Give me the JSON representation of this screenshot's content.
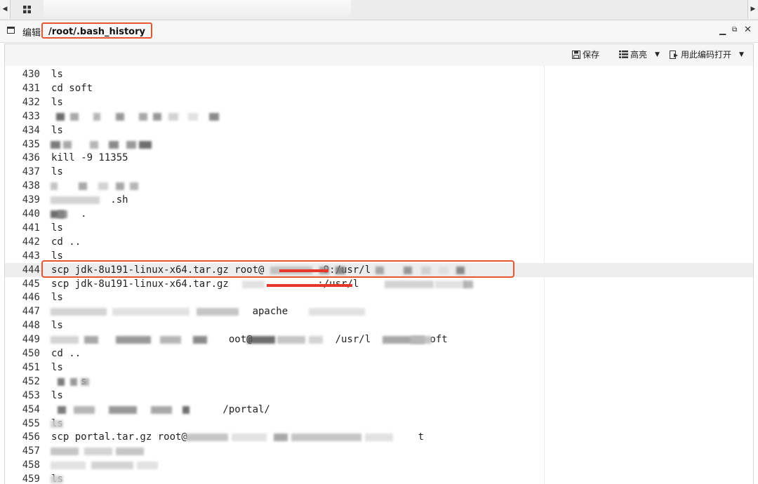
{
  "window": {
    "title_label": "编辑",
    "file_path": "/root/.bash_history"
  },
  "toolbar": {
    "save_label": "保存",
    "highlight_label": "高亮",
    "open_with_encoding_label": "用此编码打开"
  },
  "editor": {
    "lines": [
      {
        "num": "430",
        "text": "ls"
      },
      {
        "num": "431",
        "text": "cd soft"
      },
      {
        "num": "432",
        "text": "ls"
      },
      {
        "num": "433",
        "text": ""
      },
      {
        "num": "434",
        "text": "ls"
      },
      {
        "num": "435",
        "text": ""
      },
      {
        "num": "436",
        "text": "kill -9 11355"
      },
      {
        "num": "437",
        "text": "ls"
      },
      {
        "num": "438",
        "text": ""
      },
      {
        "num": "439",
        "text": "          .sh"
      },
      {
        "num": "440",
        "text": "     ."
      },
      {
        "num": "441",
        "text": "ls"
      },
      {
        "num": "442",
        "text": "cd .."
      },
      {
        "num": "443",
        "text": "ls"
      },
      {
        "num": "444",
        "text": "scp jdk-8u191-linux-x64.tar.gz root@          9:/usr/l"
      },
      {
        "num": "445",
        "text": "scp jdk-8u191-linux-x64.tar.gz               :/usr/l"
      },
      {
        "num": "446",
        "text": "ls"
      },
      {
        "num": "447",
        "text": "                                  apache"
      },
      {
        "num": "448",
        "text": "ls"
      },
      {
        "num": "449",
        "text": "                              oot@              /usr/l          oft"
      },
      {
        "num": "450",
        "text": "cd .."
      },
      {
        "num": "451",
        "text": "ls"
      },
      {
        "num": "452",
        "text": "     s"
      },
      {
        "num": "453",
        "text": "ls"
      },
      {
        "num": "454",
        "text": "                             /portal/"
      },
      {
        "num": "455",
        "text": "ls"
      },
      {
        "num": "456",
        "text": "scp portal.tar.gz root@                                       t"
      },
      {
        "num": "457",
        "text": ""
      },
      {
        "num": "458",
        "text": ""
      },
      {
        "num": "459",
        "text": "ls"
      }
    ]
  }
}
